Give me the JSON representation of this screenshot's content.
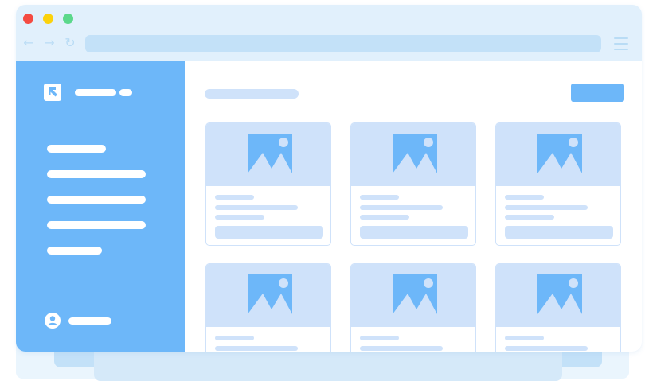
{
  "window": {
    "traffic_lights": {
      "close_color": "#f44b42",
      "minimize_color": "#fbd20c",
      "zoom_color": "#5bd88b"
    },
    "nav": {
      "back_glyph": "←",
      "forward_glyph": "→",
      "reload_glyph": "↻"
    },
    "icons": [
      "back-arrow-icon",
      "forward-arrow-icon",
      "reload-icon",
      "menu-icon"
    ]
  },
  "sidebar": {
    "background": "#6db7f9",
    "logo_icon": "arrow-up-left-icon",
    "item_count": 5,
    "user_icon": "user-icon"
  },
  "main": {
    "accent_button_color": "#6db7f9",
    "placeholder_color": "#cfe2fa",
    "card_image_icon": "image-placeholder-icon",
    "card_count": 6
  }
}
